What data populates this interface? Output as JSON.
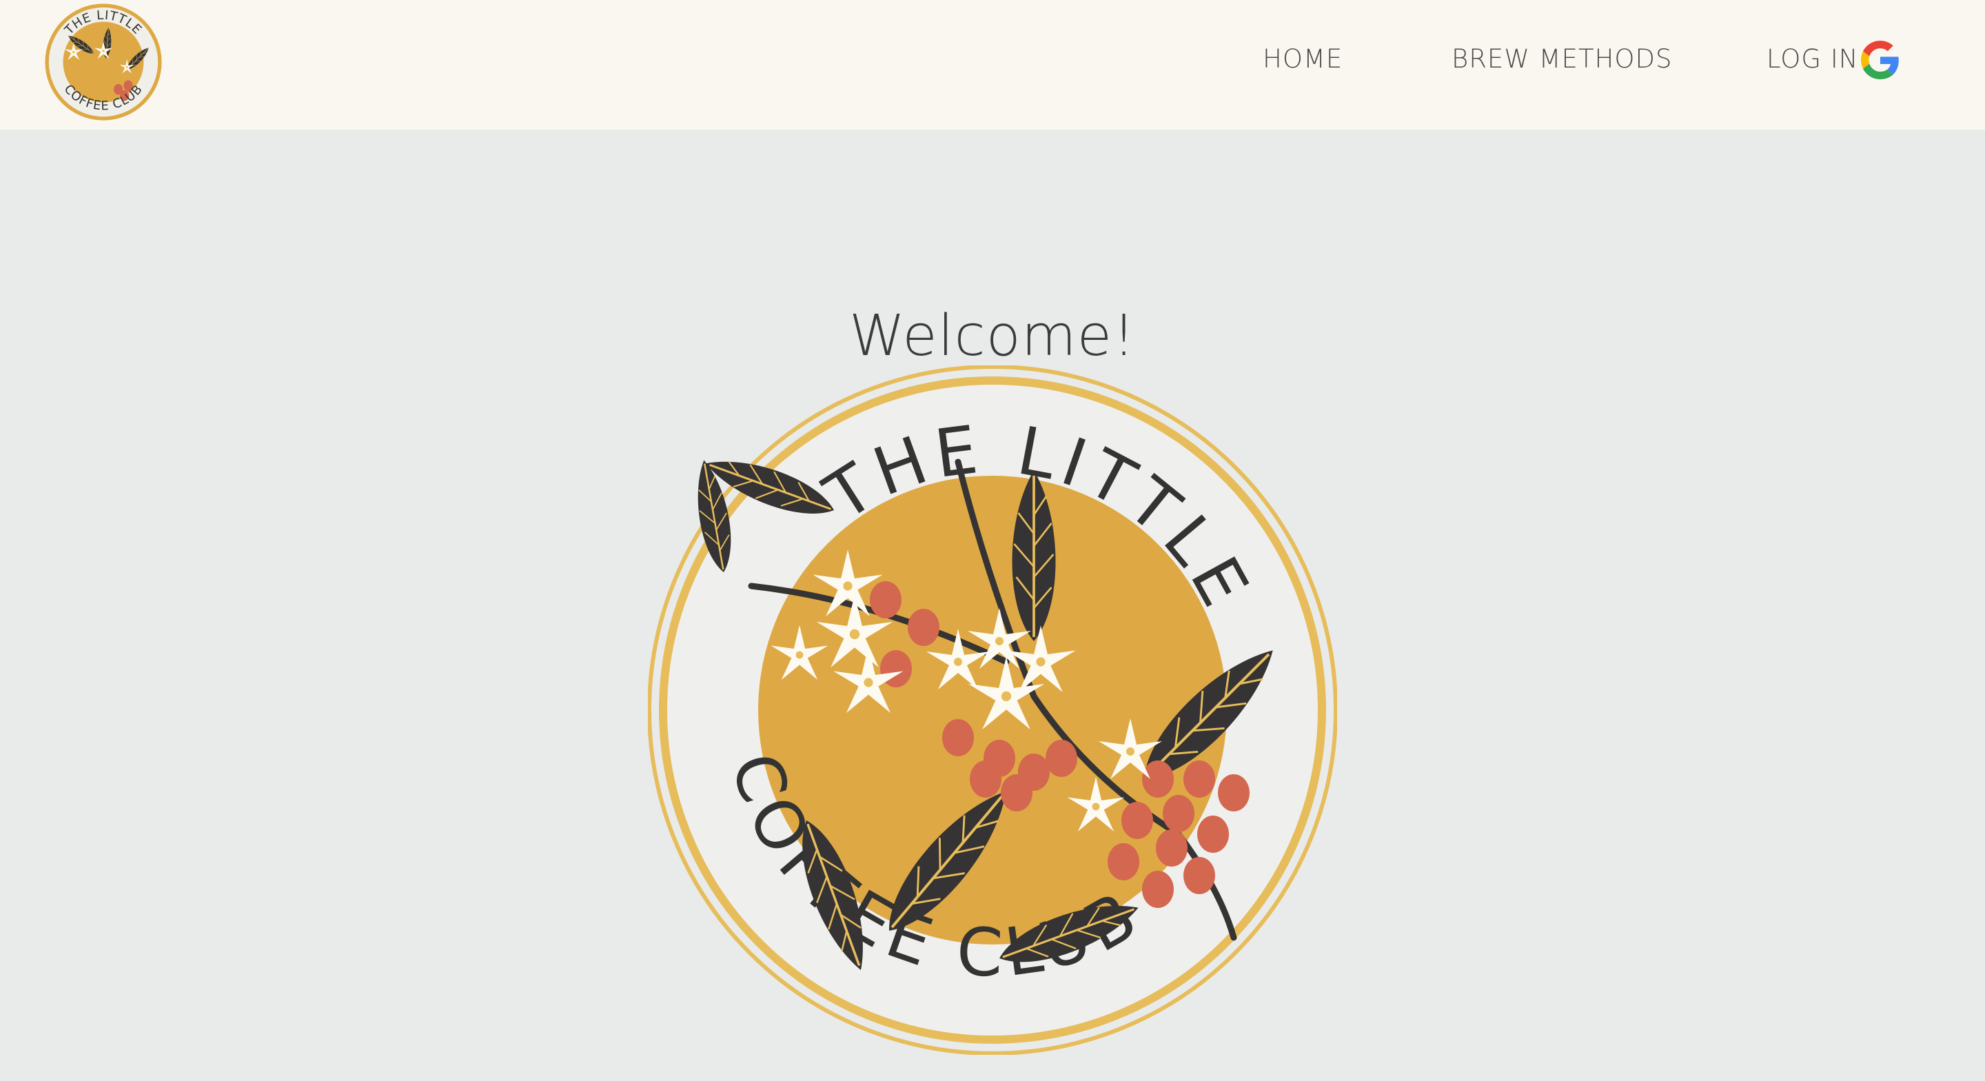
{
  "brand": {
    "line1": "THE LITTLE",
    "line2": "COFFEE CLUB"
  },
  "nav": {
    "home": "HOME",
    "brew_methods": "BREW METHODS",
    "log_in": "LOG IN"
  },
  "icons": {
    "login_provider": "google-icon",
    "logo": "coffee-branch-logo-icon"
  },
  "main": {
    "welcome": "Welcome!"
  },
  "colors": {
    "navbar_bg": "#faf7f1",
    "page_bg": "#e8ebea",
    "gold": "#dea944",
    "ring": "#e7bd5c",
    "leaf": "#353333",
    "berry": "#d4674f",
    "flower": "#fdfaf1"
  }
}
